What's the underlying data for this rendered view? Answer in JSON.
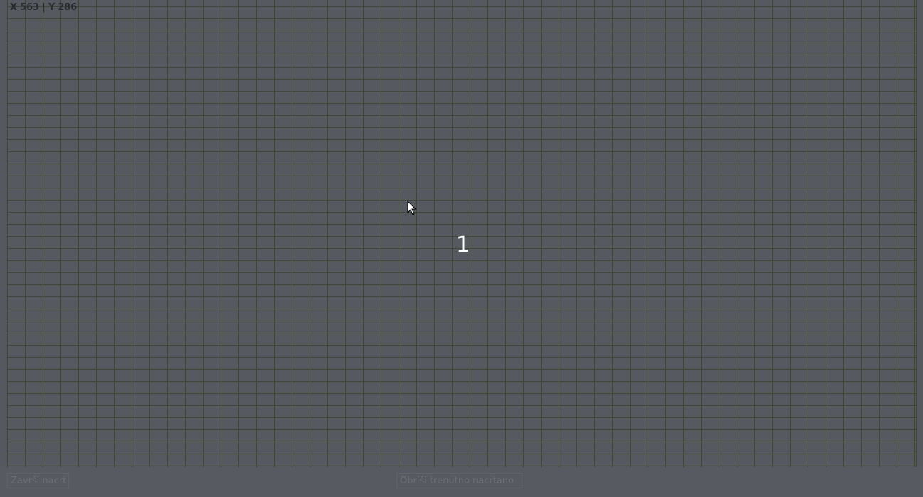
{
  "coordinates": {
    "text": "X 563 | Y 286"
  },
  "canvas": {
    "counter": "1"
  },
  "buttons": {
    "close_label": "Završi nacrt",
    "clear_label": "Obriši trenutno nacrtano"
  },
  "icons": {
    "cursor": "mouse-pointer-icon"
  },
  "colors": {
    "background": "#55585f",
    "grid_line": "#3c4a30",
    "counter_text": "#ffffff"
  }
}
